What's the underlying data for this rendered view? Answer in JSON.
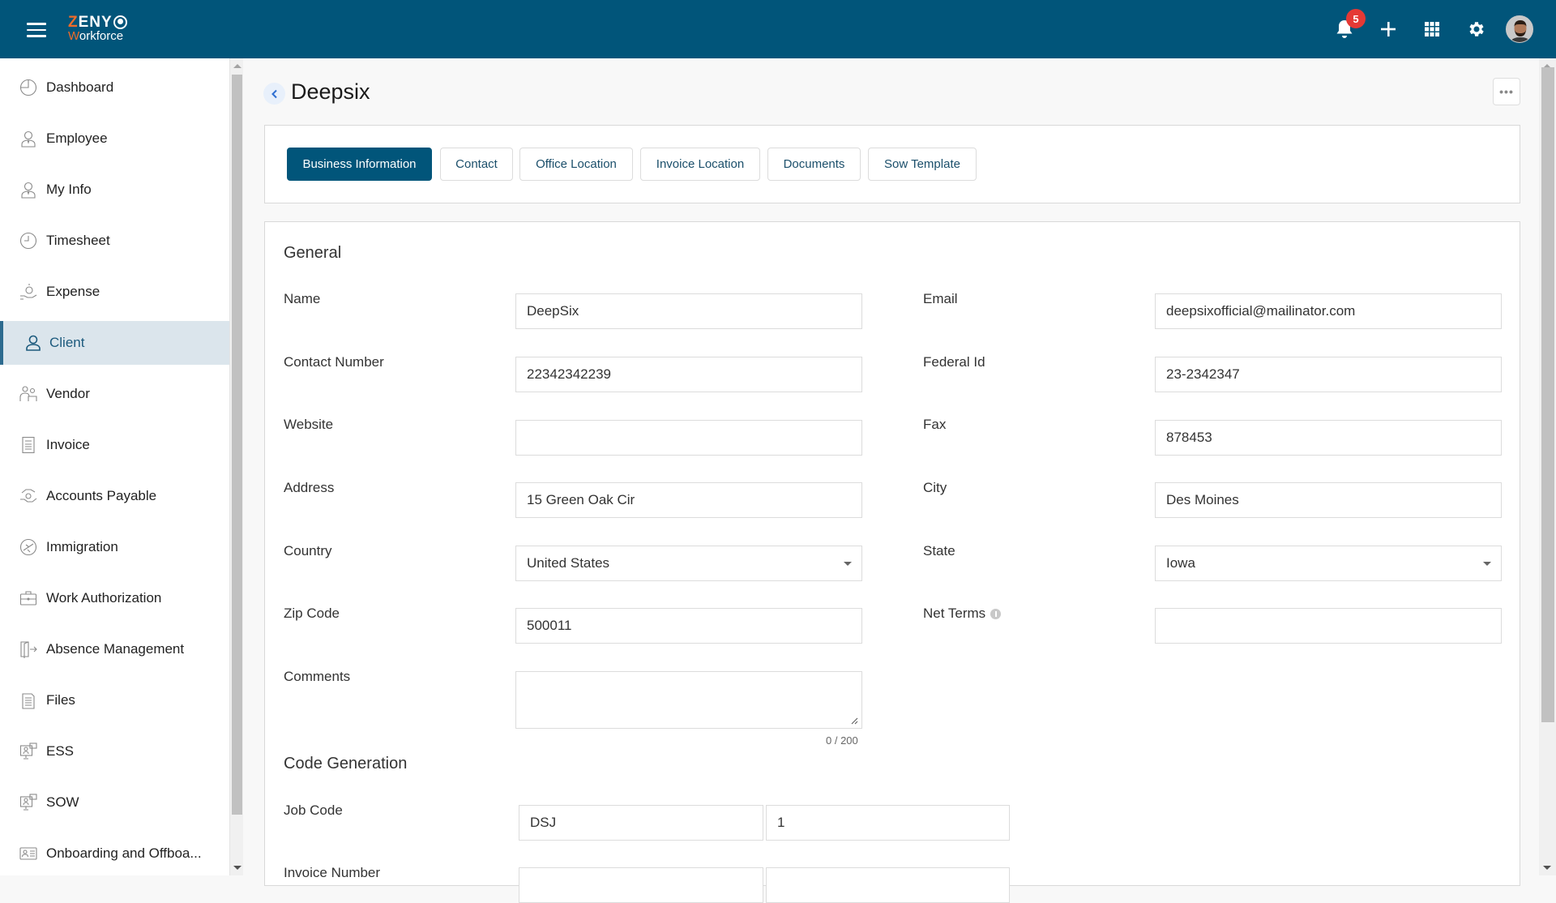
{
  "header": {
    "logo_line1_accent": "Z",
    "logo_line1_rest": "ENY",
    "logo_line2_accent": "W",
    "logo_line2_rest": "orkforce",
    "notification_count": "5",
    "brand_color": "#01557a",
    "accent_color": "#ef6c2a",
    "icons": [
      "menu-icon",
      "bell-icon",
      "plus-icon",
      "apps-grid-icon",
      "gear-icon",
      "avatar"
    ]
  },
  "sidebar": {
    "active": "Client",
    "items": [
      {
        "label": "Dashboard",
        "icon": "dashboard-icon"
      },
      {
        "label": "Employee",
        "icon": "employee-icon"
      },
      {
        "label": "My Info",
        "icon": "my-info-icon"
      },
      {
        "label": "Timesheet",
        "icon": "clock-icon"
      },
      {
        "label": "Expense",
        "icon": "expense-icon"
      },
      {
        "label": "Client",
        "icon": "user-icon"
      },
      {
        "label": "Vendor",
        "icon": "vendor-icon"
      },
      {
        "label": "Invoice",
        "icon": "invoice-icon"
      },
      {
        "label": "Accounts Payable",
        "icon": "accounts-payable-icon"
      },
      {
        "label": "Immigration",
        "icon": "plane-icon"
      },
      {
        "label": "Work Authorization",
        "icon": "briefcase-icon"
      },
      {
        "label": "Absence Management",
        "icon": "door-exit-icon"
      },
      {
        "label": "Files",
        "icon": "file-icon"
      },
      {
        "label": "ESS",
        "icon": "ess-icon"
      },
      {
        "label": "SOW",
        "icon": "sow-icon"
      },
      {
        "label": "Onboarding and Offboa..."
      }
    ]
  },
  "page": {
    "title": "Deepsix",
    "more_label": "•••"
  },
  "tabs": [
    {
      "label": "Business Information",
      "active": true
    },
    {
      "label": "Contact"
    },
    {
      "label": "Office Location"
    },
    {
      "label": "Invoice Location"
    },
    {
      "label": "Documents"
    },
    {
      "label": "Sow Template"
    }
  ],
  "form": {
    "general_title": "General",
    "left": [
      {
        "label": "Name",
        "value": "DeepSix"
      },
      {
        "label": "Contact Number",
        "value": "22342342239"
      },
      {
        "label": "Website",
        "value": ""
      },
      {
        "label": "Address",
        "value": "15 Green Oak Cir"
      },
      {
        "label": "Country",
        "value": "United States",
        "type": "select"
      },
      {
        "label": "Zip Code",
        "value": "500011"
      }
    ],
    "right": [
      {
        "label": "Email",
        "value": "deepsixofficial@mailinator.com"
      },
      {
        "label": "Federal Id",
        "value": "23-2342347"
      },
      {
        "label": "Fax",
        "value": "878453"
      },
      {
        "label": "City",
        "value": "Des Moines"
      },
      {
        "label": "State",
        "value": "Iowa",
        "type": "select"
      },
      {
        "label": "Net Terms",
        "value": "",
        "info": true
      }
    ],
    "comments": {
      "label": "Comments",
      "value": "",
      "counter": "0 / 200"
    },
    "code_generation_title": "Code Generation",
    "job_code": {
      "label": "Job Code",
      "prefix": "DSJ",
      "number": "1"
    },
    "invoice_number": {
      "label": "Invoice Number",
      "prefix": "",
      "number": ""
    }
  }
}
